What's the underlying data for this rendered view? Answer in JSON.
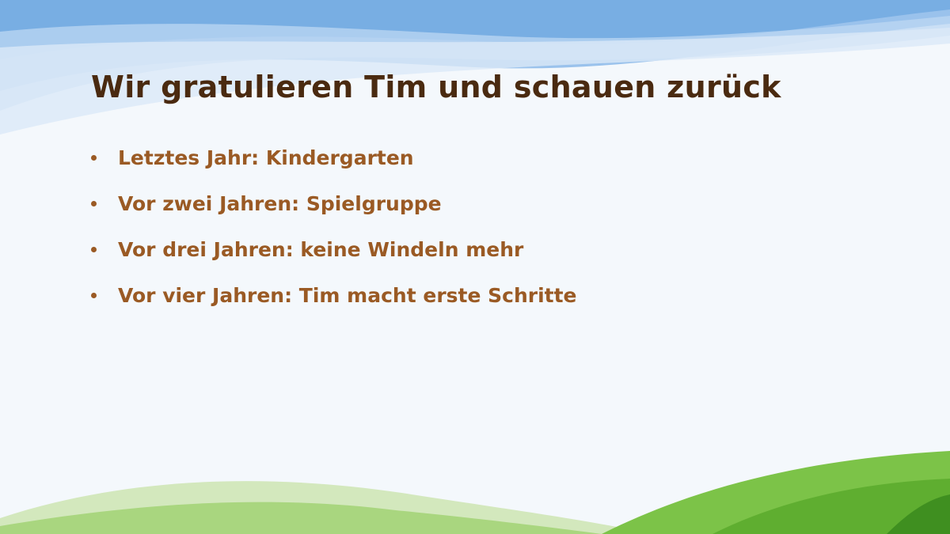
{
  "slide": {
    "title": "Wir gratulieren Tim und schauen zurück",
    "bullets": [
      "Letztes Jahr: Kindergarten",
      "Vor zwei Jahren: Spielgruppe",
      "Vor drei Jahren: keine Windeln mehr",
      "Vor vier Jahren: Tim macht erste Schritte"
    ]
  },
  "colors": {
    "background": "#f4f8fc",
    "title": "#4a2a10",
    "bullet_text": "#9a5a24",
    "sky": "#7fb2e6",
    "grass": "#6fb83a"
  }
}
